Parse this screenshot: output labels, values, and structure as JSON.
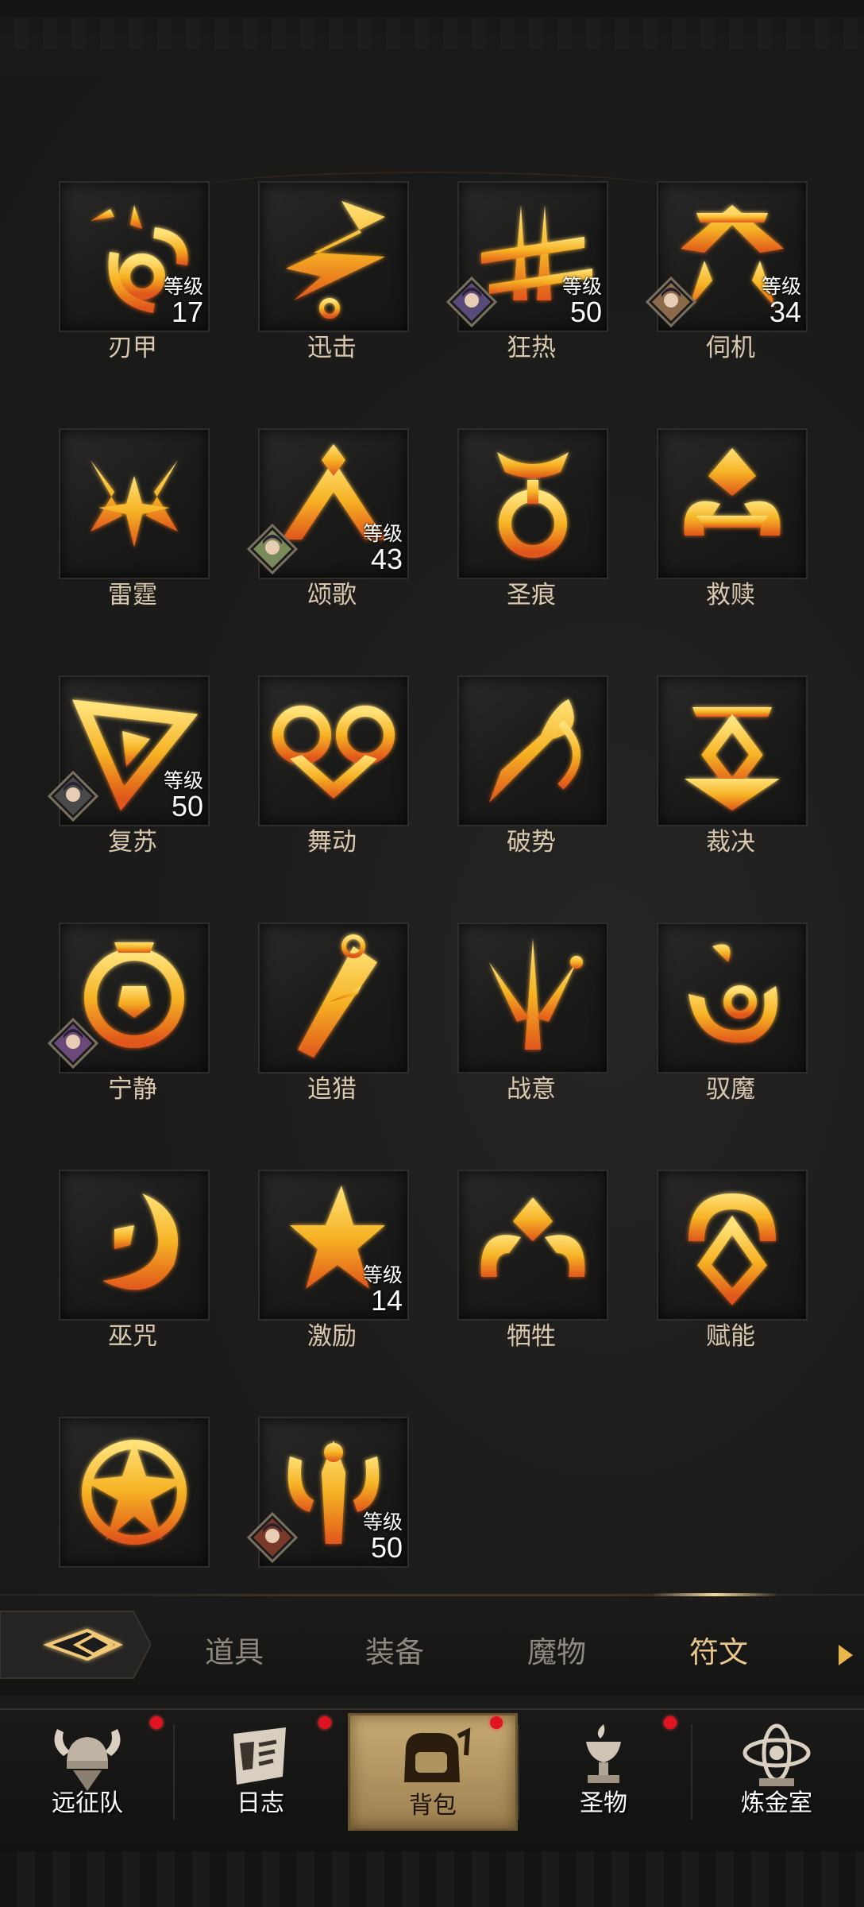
{
  "runes": [
    {
      "name": "刃甲",
      "level_label": "等级",
      "level": "17",
      "has_avatar": false
    },
    {
      "name": "迅击",
      "level_label": "",
      "level": "",
      "has_avatar": false
    },
    {
      "name": "狂热",
      "level_label": "等级",
      "level": "50",
      "has_avatar": true
    },
    {
      "name": "伺机",
      "level_label": "等级",
      "level": "34",
      "has_avatar": true
    },
    {
      "name": "雷霆",
      "level_label": "",
      "level": "",
      "has_avatar": false
    },
    {
      "name": "颂歌",
      "level_label": "等级",
      "level": "43",
      "has_avatar": true
    },
    {
      "name": "圣痕",
      "level_label": "",
      "level": "",
      "has_avatar": false
    },
    {
      "name": "救赎",
      "level_label": "",
      "level": "",
      "has_avatar": false
    },
    {
      "name": "复苏",
      "level_label": "等级",
      "level": "50",
      "has_avatar": true
    },
    {
      "name": "舞动",
      "level_label": "",
      "level": "",
      "has_avatar": false
    },
    {
      "name": "破势",
      "level_label": "",
      "level": "",
      "has_avatar": false
    },
    {
      "name": "裁决",
      "level_label": "",
      "level": "",
      "has_avatar": false
    },
    {
      "name": "宁静",
      "level_label": "",
      "level": "",
      "has_avatar": true
    },
    {
      "name": "追猎",
      "level_label": "",
      "level": "",
      "has_avatar": false
    },
    {
      "name": "战意",
      "level_label": "",
      "level": "",
      "has_avatar": false
    },
    {
      "name": "驭魔",
      "level_label": "",
      "level": "",
      "has_avatar": false
    },
    {
      "name": "巫咒",
      "level_label": "",
      "level": "",
      "has_avatar": false
    },
    {
      "name": "激励",
      "level_label": "等级",
      "level": "14",
      "has_avatar": false
    },
    {
      "name": "牺牲",
      "level_label": "",
      "level": "",
      "has_avatar": false
    },
    {
      "name": "赋能",
      "level_label": "",
      "level": "",
      "has_avatar": false
    },
    {
      "name": "",
      "level_label": "",
      "level": "",
      "has_avatar": false
    },
    {
      "name": "",
      "level_label": "等级",
      "level": "50",
      "has_avatar": true
    }
  ],
  "tabs": [
    {
      "label": "道具",
      "active": false
    },
    {
      "label": "装备",
      "active": false
    },
    {
      "label": "魔物",
      "active": false
    },
    {
      "label": "符文",
      "active": true
    }
  ],
  "nav": [
    {
      "label": "远征队",
      "icon": "viking-helmet-icon",
      "badge": true,
      "active": false
    },
    {
      "label": "日志",
      "icon": "scroll-icon",
      "badge": true,
      "active": false
    },
    {
      "label": "背包",
      "icon": "backpack-icon",
      "badge": true,
      "active": true
    },
    {
      "label": "圣物",
      "icon": "relic-chalice-icon",
      "badge": true,
      "active": false
    },
    {
      "label": "炼金室",
      "icon": "alchemy-icon",
      "badge": false,
      "active": false
    }
  ],
  "colors": {
    "rune_gold": "#f6b325",
    "rune_orange": "#e8641a",
    "tab_active": "#e9c78d",
    "tab_inactive": "#8e887f",
    "badge_red": "#e01420",
    "nav_active_bg": "#c9ac73"
  }
}
